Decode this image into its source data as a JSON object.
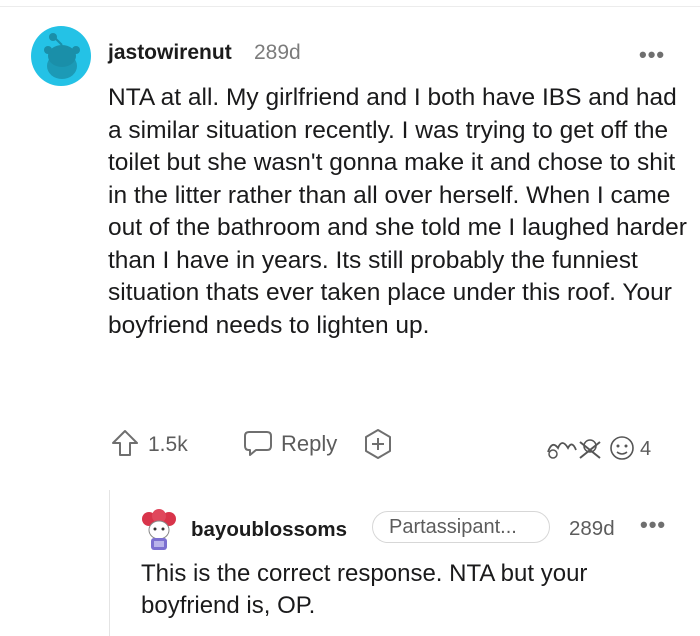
{
  "comment": {
    "username": "jastowirenut",
    "age": "289d",
    "more": "•••",
    "body": "NTA at all. My girlfriend and I both have IBS and had a similar situation recently. I was trying to get off the toilet but she wasn't gonna make it and chose to shit in the litter rather than all over herself. When I came out of the bathroom and she told me I laughed harder than I have in years. Its still probably the funniest situation thats ever taken place under this roof. Your boyfriend needs to lighten up.",
    "votes": "1.5k",
    "reply_label": "Reply",
    "award_count": "4",
    "avatar_color": "#24c2e6"
  },
  "reply": {
    "username": "bayoublossoms",
    "flair": "Partassipant...",
    "age": "289d",
    "more": "•••",
    "body": "This is the correct response. NTA but your boyfriend is, OP."
  }
}
